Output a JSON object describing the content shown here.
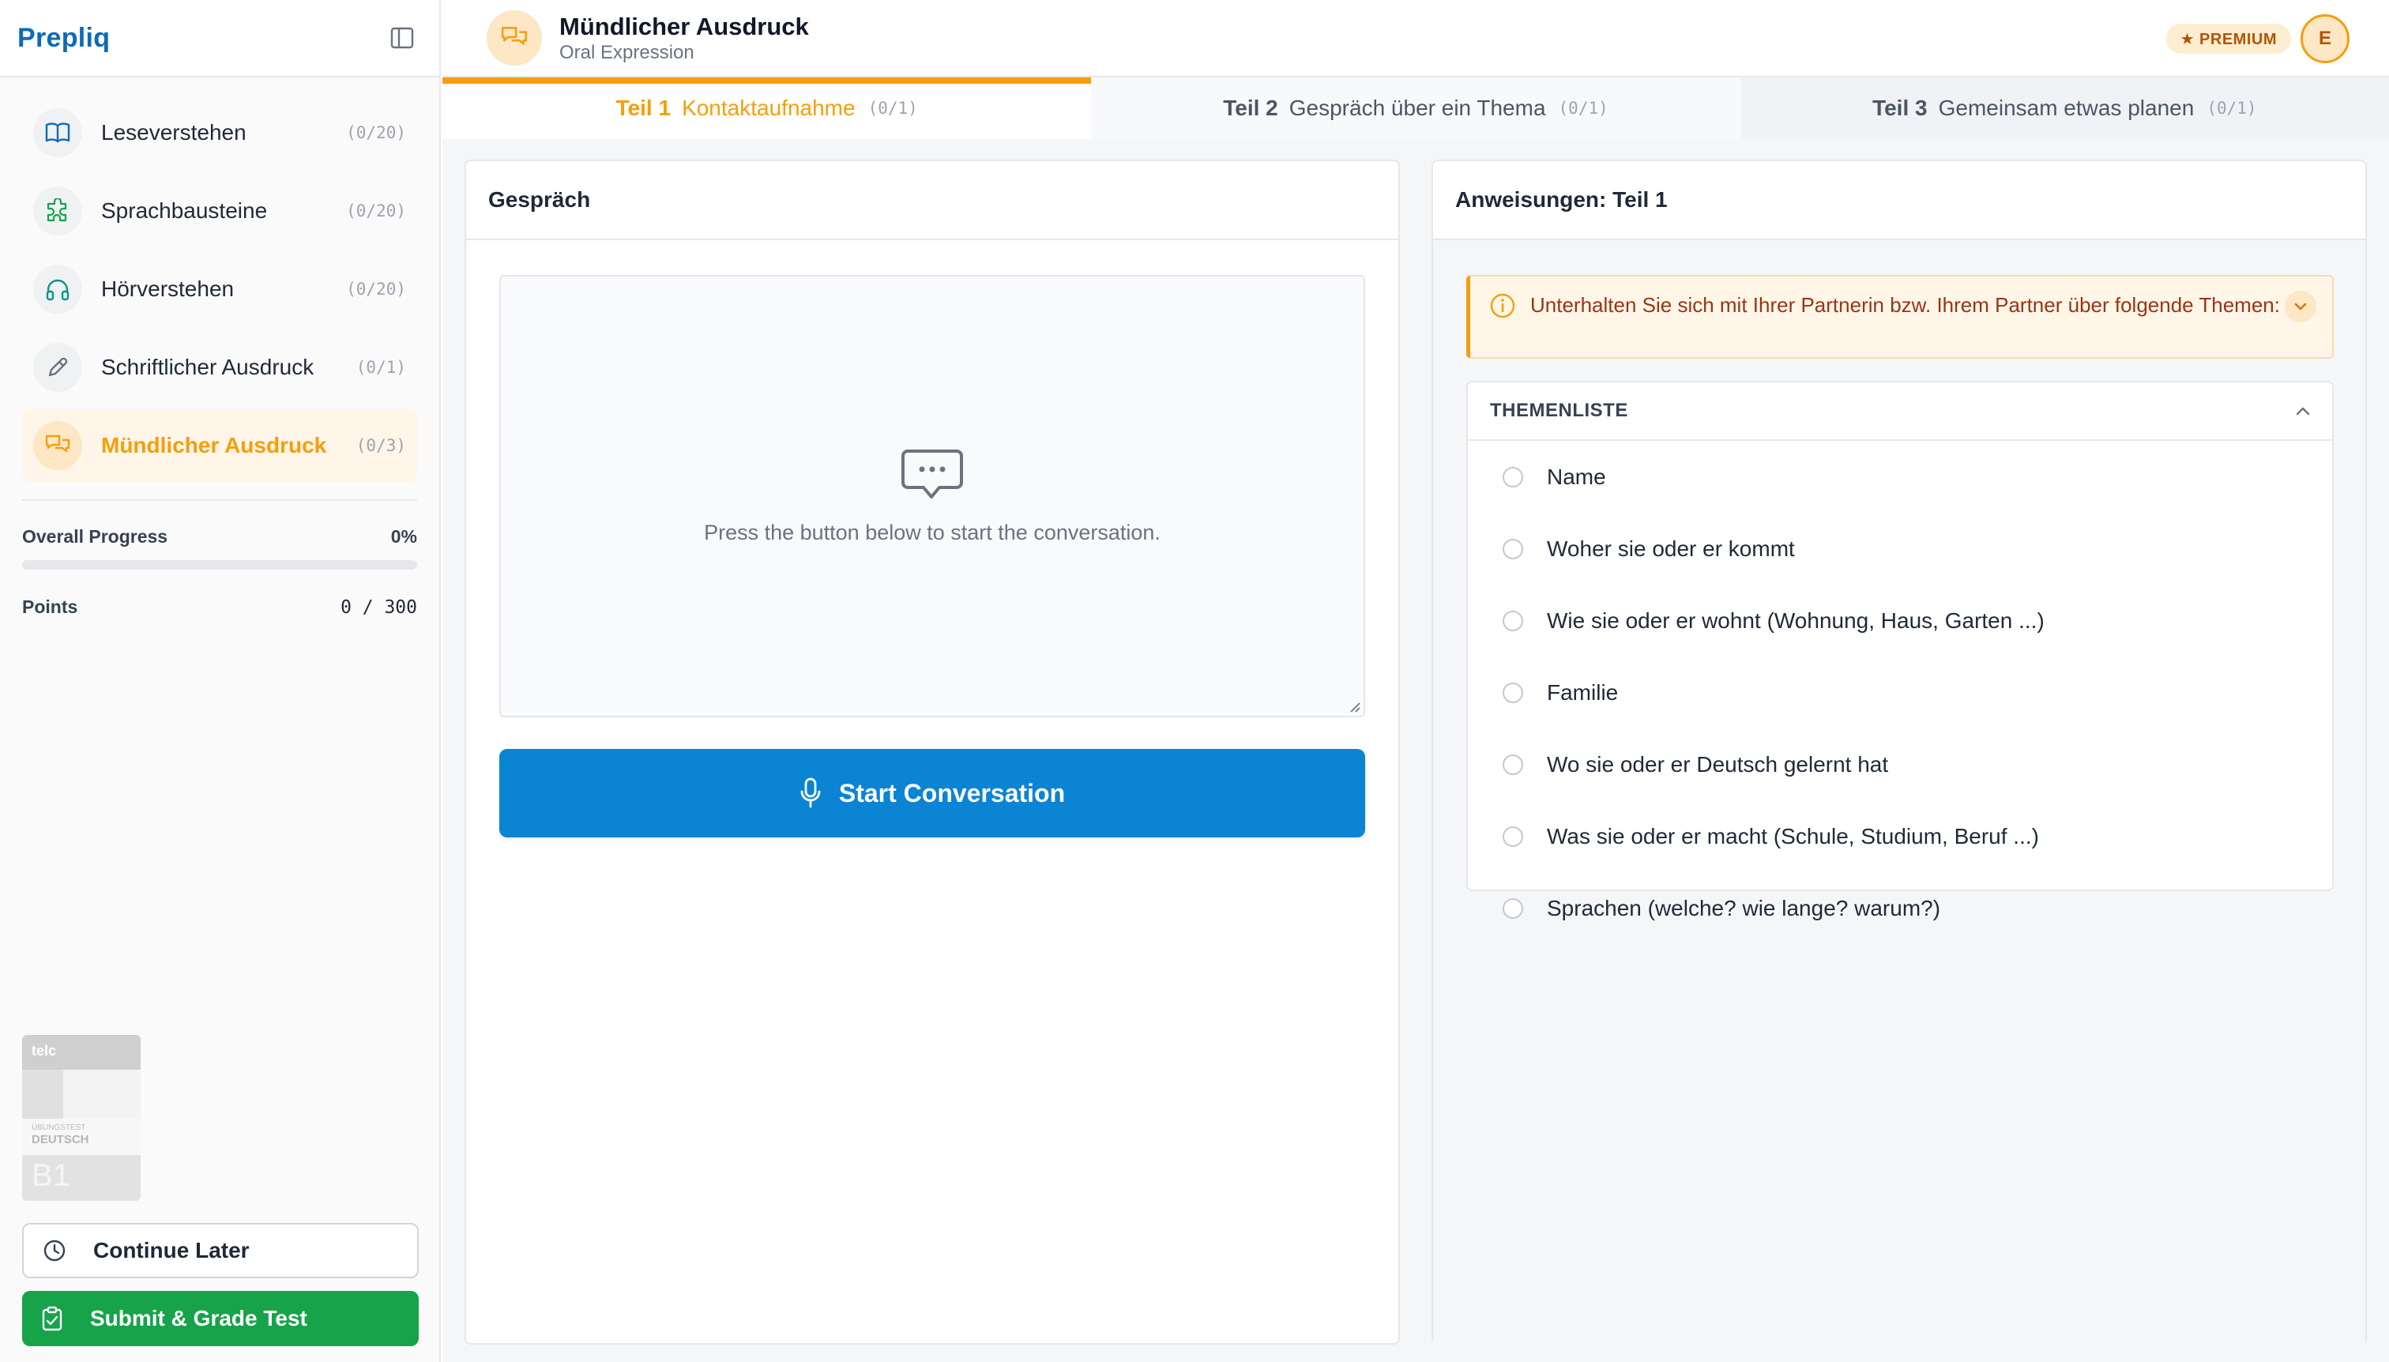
{
  "app": {
    "brand": "Prepliq"
  },
  "sidebar": {
    "items": [
      {
        "label": "Leseverstehen",
        "count": "(0/20)"
      },
      {
        "label": "Sprachbausteine",
        "count": "(0/20)"
      },
      {
        "label": "Hörverstehen",
        "count": "(0/20)"
      },
      {
        "label": "Schriftlicher Ausdruck",
        "count": "(0/1)"
      },
      {
        "label": "Mündlicher Ausdruck",
        "count": "(0/3)"
      }
    ],
    "overall_progress_label": "Overall Progress",
    "overall_progress_value": "0%",
    "overall_progress_fraction": 0,
    "points_label": "Points",
    "points_value": "0 / 300",
    "book": {
      "brand": "telc",
      "subtitle": "ÜBUNGSTEST",
      "language": "DEUTSCH",
      "level": "B1"
    },
    "continue_later": "Continue Later",
    "submit": "Submit & Grade Test"
  },
  "header": {
    "title": "Mündlicher Ausdruck",
    "subtitle": "Oral Expression",
    "premium": "★ PREMIUM",
    "avatar": "E"
  },
  "tabs": [
    {
      "num": "Teil 1",
      "label": "Kontaktaufnahme",
      "count": "(0/1)"
    },
    {
      "num": "Teil 2",
      "label": "Gespräch über ein Thema",
      "count": "(0/1)"
    },
    {
      "num": "Teil 3",
      "label": "Gemeinsam etwas planen",
      "count": "(0/1)"
    }
  ],
  "conversation": {
    "title": "Gespräch",
    "hint": "Press the button below to start the conversation.",
    "start": "Start Conversation"
  },
  "instructions": {
    "title": "Anweisungen: Teil 1",
    "notice": "Unterhalten Sie sich mit Ihrer Partnerin bzw. Ihrem Partner über folgende Themen:",
    "topics_heading": "THEMENLISTE",
    "topics": [
      "Name",
      "Woher sie oder er kommt",
      "Wie sie oder er wohnt (Wohnung, Haus, Garten ...)",
      "Familie",
      "Wo sie oder er Deutsch gelernt hat",
      "Was sie oder er macht (Schule, Studium, Beruf ...)",
      "Sprachen (welche? wie lange? warum?)"
    ]
  },
  "colors": {
    "accent": "#f59e0b",
    "brand": "#0b6bb8",
    "primary": "#0b84d4",
    "success": "#16a34a"
  }
}
